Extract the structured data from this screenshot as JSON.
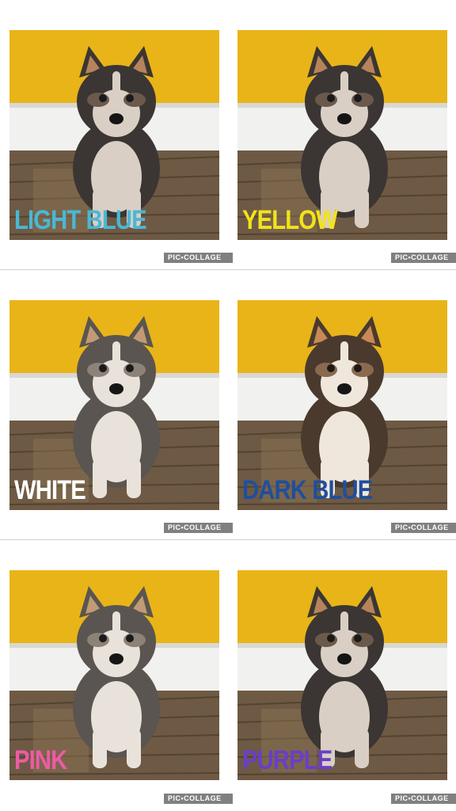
{
  "watermark": "PIC•COLLAGE",
  "photos": [
    {
      "label": "LIGHT BLUE",
      "color": "#49b8d6",
      "style": "dark"
    },
    {
      "label": "YELLOW",
      "color": "#f2e31a",
      "style": "dark"
    },
    {
      "label": "WHITE",
      "color": "#ffffff",
      "style": "gray"
    },
    {
      "label": "DARK BLUE",
      "color": "#1f4f9c",
      "style": "brown"
    },
    {
      "label": "PINK",
      "color": "#ee5aa6",
      "style": "gray"
    },
    {
      "label": "PURPLE",
      "color": "#6a3ec8",
      "style": "dark"
    }
  ]
}
